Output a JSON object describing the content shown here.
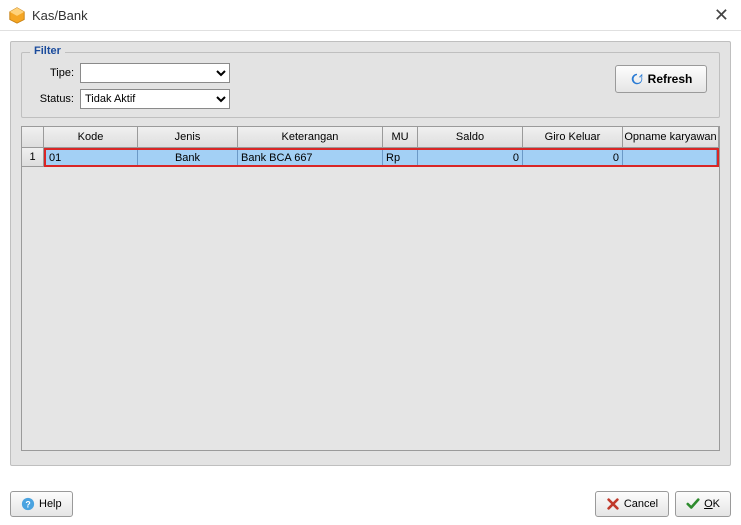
{
  "window": {
    "title": "Kas/Bank"
  },
  "filter": {
    "legend": "Filter",
    "tipe_label": "Tipe:",
    "tipe_value": "",
    "status_label": "Status:",
    "status_value": "Tidak Aktif",
    "refresh_label": "Refresh"
  },
  "grid": {
    "headers": {
      "kode": "Kode",
      "jenis": "Jenis",
      "keterangan": "Keterangan",
      "mu": "MU",
      "saldo": "Saldo",
      "giro_keluar": "Giro Keluar",
      "opname": "Opname karyawan"
    },
    "rows": [
      {
        "num": "1",
        "kode": "01",
        "jenis": "Bank",
        "keterangan": "Bank BCA 667",
        "mu": "Rp",
        "saldo": "0",
        "giro_keluar": "0",
        "opname": ""
      }
    ]
  },
  "buttons": {
    "help": "Help",
    "cancel": "Cancel",
    "ok_prefix": "O",
    "ok_rest": "K"
  }
}
